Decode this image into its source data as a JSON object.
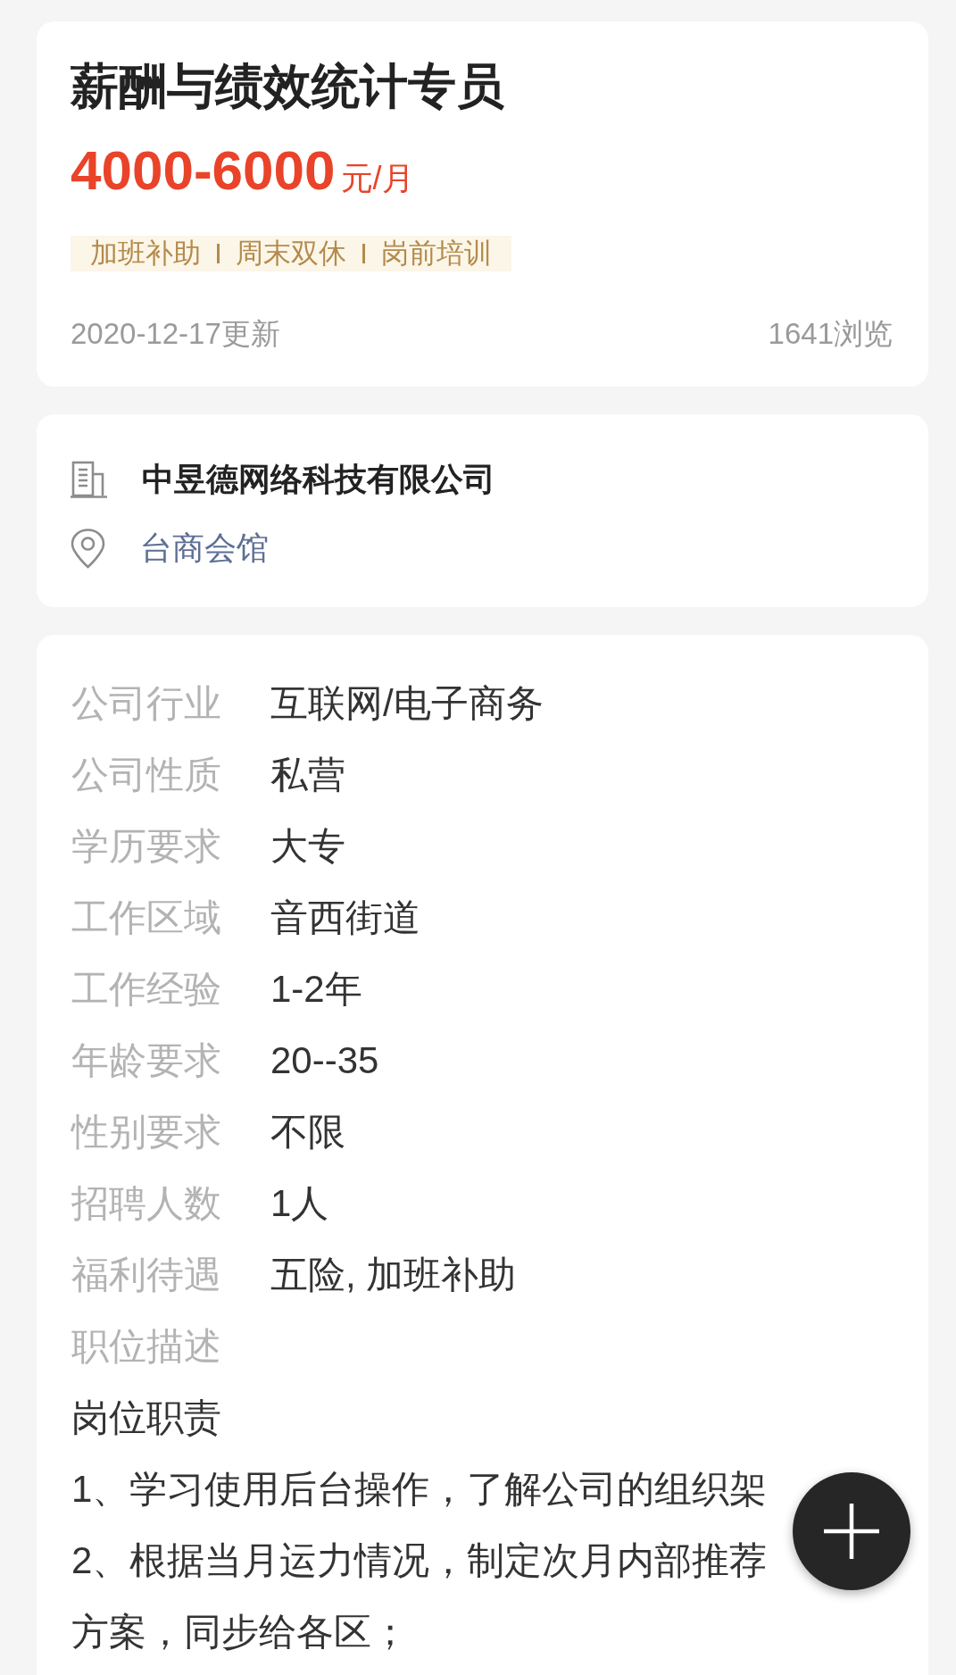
{
  "job": {
    "title": "薪酬与绩效统计专员",
    "salary": {
      "amount": "4000-6000",
      "unit": "元/月"
    },
    "benefit_tags": [
      "加班补助",
      "周末双休",
      "岗前培训"
    ],
    "updated": "2020-12-17更新",
    "views": "1641浏览"
  },
  "company": {
    "name": "中昱德网络科技有限公司",
    "location": "台商会馆"
  },
  "details": [
    {
      "label": "公司行业",
      "value": "互联网/电子商务"
    },
    {
      "label": "公司性质",
      "value": "私营"
    },
    {
      "label": "学历要求",
      "value": "大专"
    },
    {
      "label": "工作区域",
      "value": "音西街道"
    },
    {
      "label": "工作经验",
      "value": "1-2年"
    },
    {
      "label": "年龄要求",
      "value": "20--35"
    },
    {
      "label": "性别要求",
      "value": "不限"
    },
    {
      "label": "招聘人数",
      "value": "1人"
    },
    {
      "label": "福利待遇",
      "value": "五险, 加班补助"
    }
  ],
  "description": {
    "label": "职位描述",
    "lines": [
      "岗位职责",
      "1、学习使用后台操作，了解公司的组织架",
      "2、根据当月运力情况，制定次月内部推荐",
      "方案，同步给各区；"
    ]
  }
}
